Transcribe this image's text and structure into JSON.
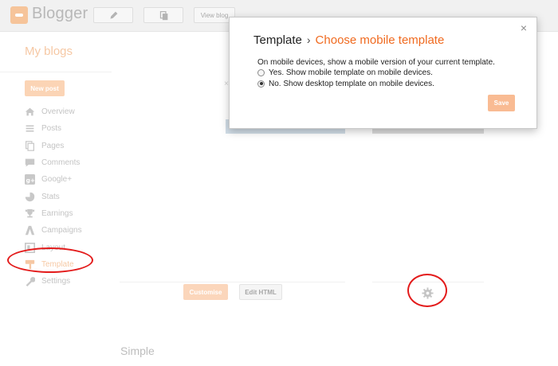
{
  "header": {
    "logo_text": "Blogger",
    "view_blog_label": "View blog"
  },
  "sidebar": {
    "title": "My blogs",
    "new_post_label": "New post",
    "items": [
      {
        "label": "Overview",
        "icon": "home-icon"
      },
      {
        "label": "Posts",
        "icon": "posts-icon"
      },
      {
        "label": "Pages",
        "icon": "pages-icon"
      },
      {
        "label": "Comments",
        "icon": "comment-icon"
      },
      {
        "label": "Google+",
        "icon": "google-plus-icon"
      },
      {
        "label": "Stats",
        "icon": "pie-chart-icon"
      },
      {
        "label": "Earnings",
        "icon": "trophy-icon"
      },
      {
        "label": "Campaigns",
        "icon": "campaigns-icon"
      },
      {
        "label": "Layout",
        "icon": "layout-icon"
      },
      {
        "label": "Template",
        "icon": "template-icon",
        "active": true
      },
      {
        "label": "Settings",
        "icon": "wrench-icon"
      }
    ]
  },
  "main": {
    "customise_label": "Customise",
    "edit_html_label": "Edit HTML",
    "section_title": "Simple"
  },
  "dialog": {
    "title": "Template",
    "separator": "›",
    "subtitle": "Choose mobile template",
    "close_glyph": "×",
    "description": "On mobile devices, show a mobile version of your current template.",
    "options": [
      {
        "label": "Yes. Show mobile template on mobile devices.",
        "checked": false
      },
      {
        "label": "No. Show desktop template on mobile devices.",
        "checked": true
      }
    ],
    "save_label": "Save"
  },
  "colors": {
    "accent_orange": "#f06a1f",
    "annotation_red": "#e31b1b",
    "save_button": "#f9bb93"
  }
}
